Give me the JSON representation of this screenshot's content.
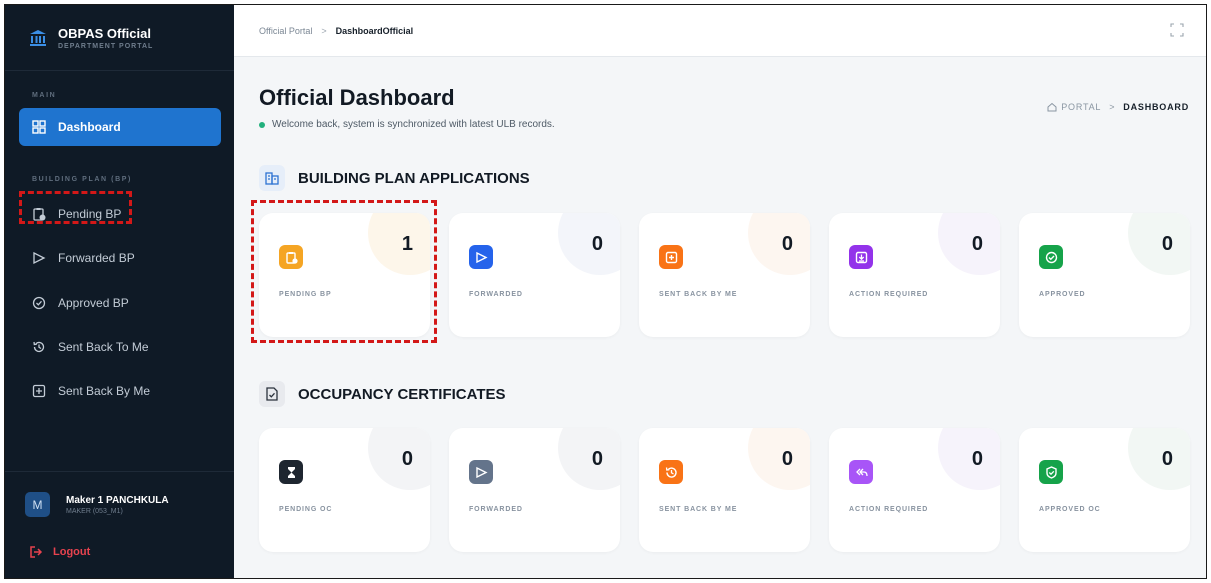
{
  "brand": {
    "title": "OBPAS Official",
    "subtitle": "DEPARTMENT PORTAL"
  },
  "sidebar": {
    "section_main": "MAIN",
    "section_bp": "BUILDING PLAN (BP)",
    "items": [
      {
        "label": "Dashboard",
        "icon": "dashboard-grid-icon",
        "active": true
      },
      {
        "label": "Pending BP",
        "icon": "clipboard-clock-icon"
      },
      {
        "label": "Forwarded BP",
        "icon": "send-icon"
      },
      {
        "label": "Approved BP",
        "icon": "check-badge-icon"
      },
      {
        "label": "Sent Back To Me",
        "icon": "history-icon"
      },
      {
        "label": "Sent Back By Me",
        "icon": "return-box-icon"
      }
    ]
  },
  "user": {
    "initial": "M",
    "name": "Maker 1 PANCHKULA",
    "role": "MAKER (053_M1)"
  },
  "logout_label": "Logout",
  "topbar": {
    "crumb_root": "Official Portal",
    "crumb_sep": ">",
    "crumb_current": "DashboardOfficial"
  },
  "header": {
    "title": "Official Dashboard",
    "welcome": "Welcome back, system is synchronized with latest ULB records.",
    "crumb_portal": "PORTAL",
    "crumb_sep": ">",
    "crumb_current": "DASHBOARD"
  },
  "bp_section": {
    "title": "BUILDING PLAN APPLICATIONS",
    "cards": [
      {
        "label": "PENDING BP",
        "value": "1",
        "color": "#f5a524",
        "bubble": "#fdf6ea",
        "icon": "clipboard-clock-icon"
      },
      {
        "label": "FORWARDED",
        "value": "0",
        "color": "#2563eb",
        "bubble": "#f3f5fa",
        "icon": "send-icon"
      },
      {
        "label": "SENT BACK BY ME",
        "value": "0",
        "color": "#f97316",
        "bubble": "#fdf6f0",
        "icon": "return-box-icon"
      },
      {
        "label": "ACTION REQUIRED",
        "value": "0",
        "color": "#9333ea",
        "bubble": "#f6f3fb",
        "icon": "download-box-icon"
      },
      {
        "label": "APPROVED",
        "value": "0",
        "color": "#16a34a",
        "bubble": "#f2f7f4",
        "icon": "check-badge-icon"
      }
    ]
  },
  "oc_section": {
    "title": "OCCUPANCY CERTIFICATES",
    "cards": [
      {
        "label": "PENDING OC",
        "value": "0",
        "color": "#1e2630",
        "bubble": "#f3f4f6",
        "icon": "hourglass-icon"
      },
      {
        "label": "FORWARDED",
        "value": "0",
        "color": "#64748b",
        "bubble": "#f3f4f6",
        "icon": "send-icon"
      },
      {
        "label": "SENT BACK BY ME",
        "value": "0",
        "color": "#f97316",
        "bubble": "#fdf6f0",
        "icon": "history-icon"
      },
      {
        "label": "ACTION REQUIRED",
        "value": "0",
        "color": "#a855f7",
        "bubble": "#f6f3fb",
        "icon": "reply-all-icon"
      },
      {
        "label": "APPROVED OC",
        "value": "0",
        "color": "#16a34a",
        "bubble": "#f2f7f4",
        "icon": "shield-check-icon"
      }
    ]
  }
}
